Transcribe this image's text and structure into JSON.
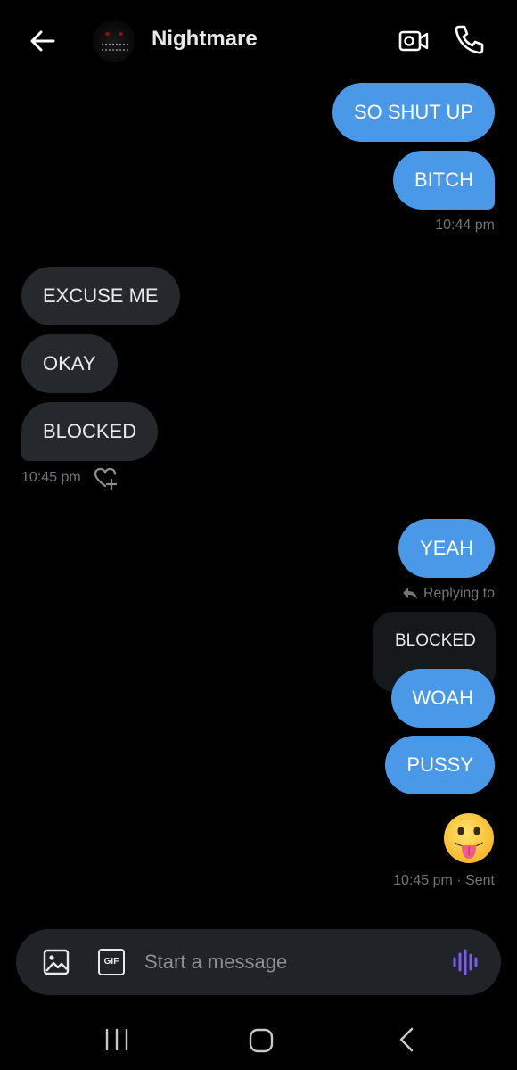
{
  "header": {
    "contact_name": "Nightmare",
    "icons": {
      "back": "arrow-left-icon",
      "video": "video-call-icon",
      "call": "phone-icon"
    }
  },
  "messages": [
    {
      "id": "m1",
      "direction": "outgoing",
      "text": "SO SHUT UP"
    },
    {
      "id": "m2",
      "direction": "outgoing",
      "text": "BITCH"
    },
    {
      "id": "t1",
      "type": "timestamp",
      "text": "10:44 pm"
    },
    {
      "id": "m3",
      "direction": "incoming",
      "text": "EXCUSE ME"
    },
    {
      "id": "m4",
      "direction": "incoming",
      "text": "OKAY"
    },
    {
      "id": "m5",
      "direction": "incoming",
      "text": "BLOCKED"
    },
    {
      "id": "t2",
      "type": "timestamp",
      "text": "10:45 pm"
    },
    {
      "id": "m6",
      "direction": "outgoing",
      "text": "YEAH"
    },
    {
      "id": "reply",
      "label": "Replying to",
      "quoted_text": "BLOCKED"
    },
    {
      "id": "m7",
      "direction": "outgoing",
      "text": "WOAH"
    },
    {
      "id": "m8",
      "direction": "outgoing",
      "text": "PUSSY"
    },
    {
      "id": "m9",
      "direction": "outgoing",
      "type": "emoji",
      "emoji": "face-with-tongue"
    },
    {
      "id": "t3",
      "type": "timestamp",
      "text": "10:45 pm · Sent"
    }
  ],
  "composer": {
    "placeholder": "Start a message",
    "gif_label": "GIF",
    "icons": {
      "image": "image-icon",
      "gif": "gif-icon",
      "voice": "voice-waveform-icon"
    }
  },
  "colors": {
    "background": "#000000",
    "outgoing_bubble": "#4a99e9",
    "incoming_bubble": "#25292d",
    "timestamp_text": "#71767b",
    "voice_accent": "#7c5cf0"
  }
}
